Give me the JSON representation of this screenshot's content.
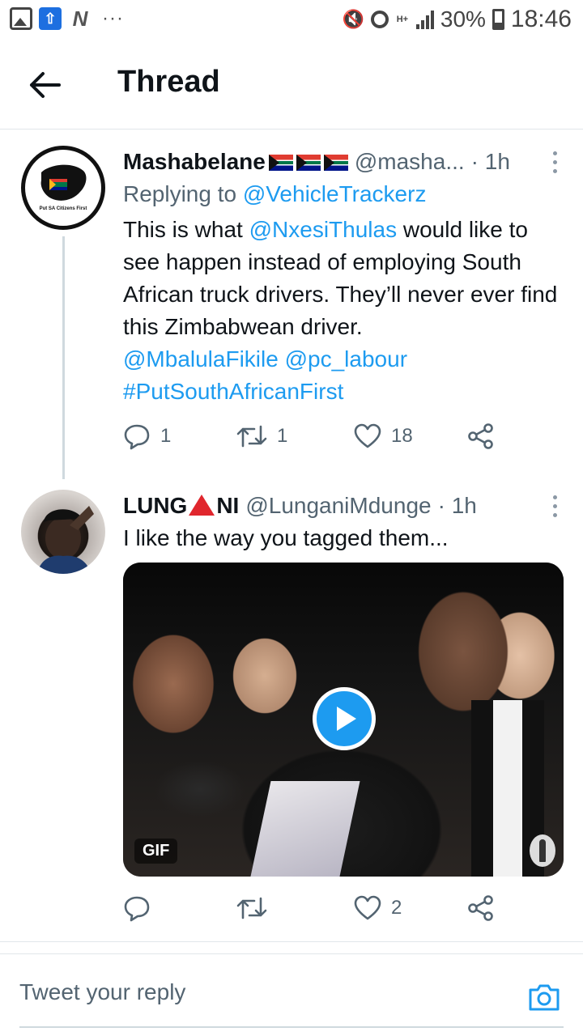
{
  "status_bar": {
    "battery": "30%",
    "time": "18:46",
    "network": "H+",
    "icons_left": [
      "gallery-icon",
      "rocket-icon",
      "n-app-icon",
      "more-notifications-icon"
    ],
    "icons_right": [
      "mute-icon",
      "alarm-icon",
      "network-icon",
      "signal-icon",
      "battery-icon"
    ]
  },
  "header": {
    "title": "Thread",
    "back_icon": "arrow-left-icon"
  },
  "tweets": [
    {
      "name": "Mashabelane",
      "handle": "@masha...",
      "time": "· 1h",
      "avatar_text": "Put SA Citizens First",
      "replying_prefix": "Replying to",
      "replying_to": "@VehicleTrackerz",
      "text_1": "This is what",
      "mention_1": "@NxesiThulas",
      "text_2": "would like to see happen instead of employing South African truck drivers. They’ll never ever find this Zimbabwean driver.",
      "mention_2": "@MbalulaFikile",
      "mention_3": "@pc_labour",
      "hashtag": "#PutSouthAfricanFirst",
      "replies": "1",
      "retweets": "1",
      "likes": "18"
    },
    {
      "name_a": "LUNG",
      "name_b": "NI",
      "handle": "@LunganiMdunge",
      "time": "· 1h",
      "text": "I like the way you tagged them...",
      "media_badge": "GIF",
      "replies": "",
      "retweets": "",
      "likes": "2"
    }
  ],
  "reply_bar": {
    "placeholder": "Tweet your reply"
  },
  "colors": {
    "accent": "#1d9bf0",
    "text": "#0f1419",
    "muted": "#536471",
    "divider": "#e1e6ea"
  }
}
